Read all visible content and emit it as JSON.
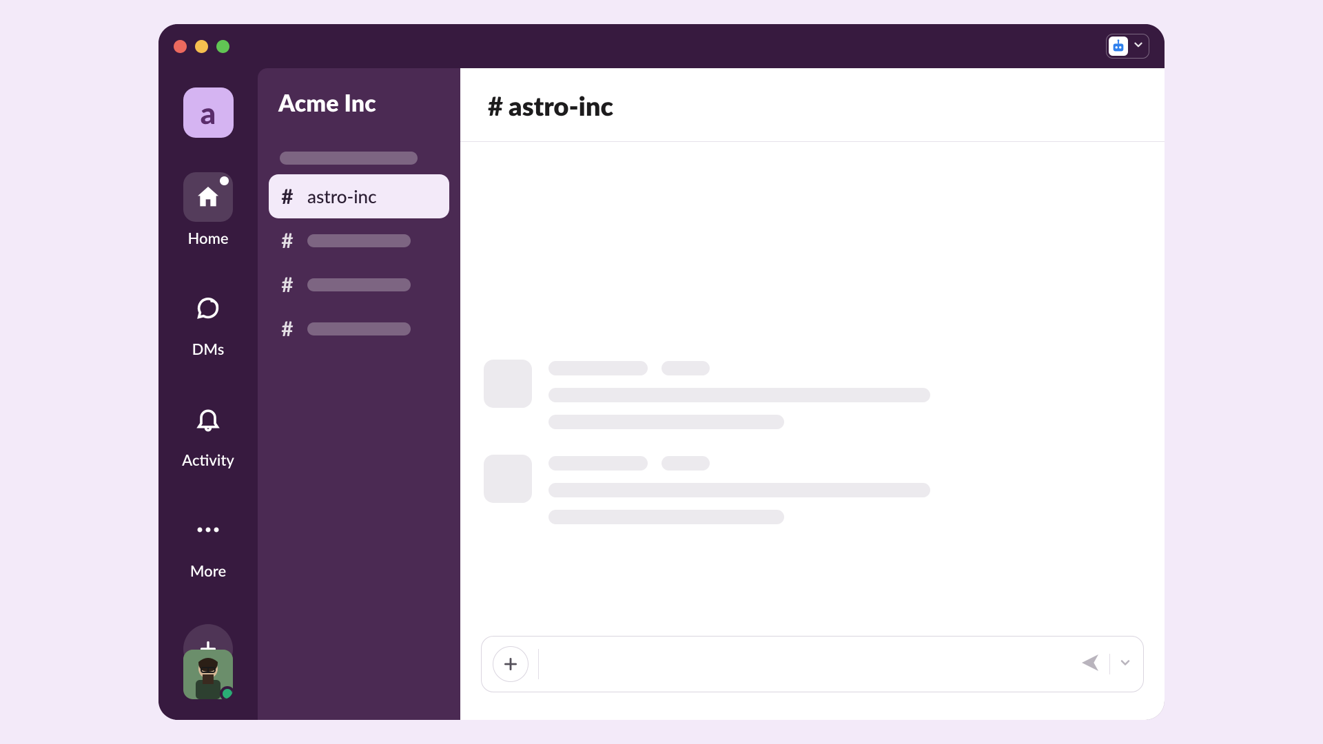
{
  "workspace": {
    "letter": "a",
    "name": "Acme Inc"
  },
  "rail": {
    "items": [
      {
        "label": "Home"
      },
      {
        "label": "DMs"
      },
      {
        "label": "Activity"
      },
      {
        "label": "More"
      }
    ]
  },
  "sidebar": {
    "selected_channel": "astro-inc"
  },
  "channel": {
    "hash": "#",
    "name": "astro-inc"
  }
}
